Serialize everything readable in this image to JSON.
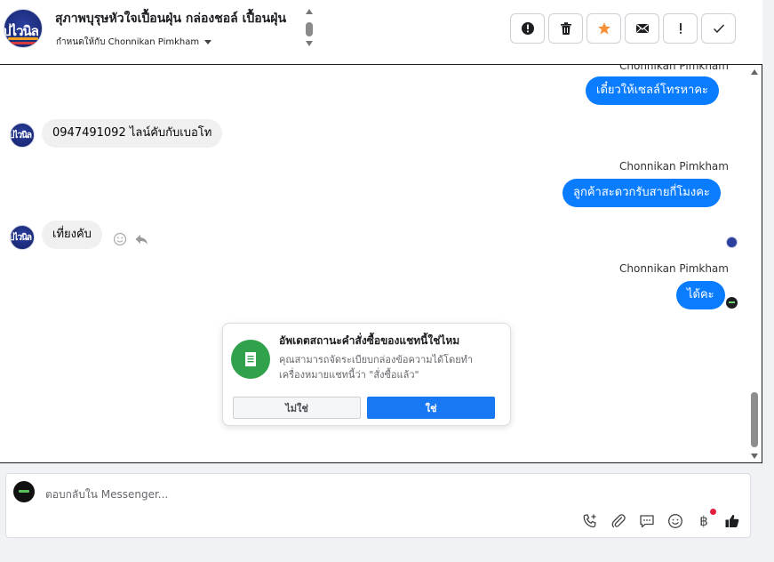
{
  "header": {
    "title": "สุภาพบุรุษหัวใจเปื้อนฝุ่น กล่องชอล์ เปื้อนฝุ่น",
    "assign_label": "กำหนดให้กับ Chonnikan Pimkham",
    "page_logo_text": "ปไวนิล",
    "toolbar": [
      {
        "name": "spam",
        "icon": "alert-circle-icon"
      },
      {
        "name": "delete",
        "icon": "trash-icon"
      },
      {
        "name": "star",
        "icon": "star-icon"
      },
      {
        "name": "mark-unread",
        "icon": "envelope-icon"
      },
      {
        "name": "follow-up",
        "icon": "exclamation-icon"
      },
      {
        "name": "done",
        "icon": "checkmark-icon"
      }
    ]
  },
  "messages": [
    {
      "sender": "Chonnikan Pimkham",
      "text": "เดี๋ยวให้เซลล์โทรหาคะ",
      "direction": "outgoing"
    },
    {
      "text": "0947491092 ไลน์คับกับเบอโท",
      "direction": "incoming"
    },
    {
      "sender": "Chonnikan Pimkham",
      "text": "ลูกค้าสะดวกรับสายกี่โมงคะ",
      "direction": "outgoing"
    },
    {
      "text": "เที่ยงคับ",
      "direction": "incoming"
    },
    {
      "sender": "Chonnikan Pimkham",
      "text": "ได้คะ",
      "direction": "outgoing"
    }
  ],
  "prompt": {
    "title": "อัพเดตสถานะคำสั่งซื้อของแชทนี้ใช่ไหม",
    "description": "คุณสามารถจัดระเบียบกล่องข้อความได้โดยทำเครื่องหมายแชทนี้ว่า \"สั่งซื้อแล้ว\"",
    "no_label": "ไม่ใช่",
    "yes_label": "ใช่"
  },
  "composer": {
    "placeholder": "ตอบกลับใน Messenger...",
    "tools": [
      "phone-plus-icon",
      "paperclip-icon",
      "saved-reply-icon",
      "emoji-icon",
      "baht-icon",
      "thumbs-up-icon"
    ],
    "baht_symbol": "฿"
  },
  "colors": {
    "outgoing_bubble": "#0a7cff",
    "incoming_bubble": "#f0f0f0",
    "primary_button": "#1877f2",
    "badge_green": "#31a24c",
    "star": "#f7923b"
  }
}
